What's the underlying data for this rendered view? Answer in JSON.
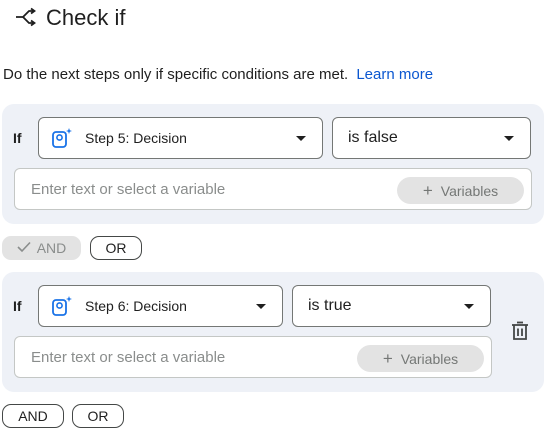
{
  "header": {
    "title": "Check if",
    "icon": "branch-icon"
  },
  "description": {
    "text": "Do the next steps only if specific conditions are met.",
    "link": "Learn more"
  },
  "condition_groups": [
    {
      "if_label": "If",
      "step": {
        "label": "Step 5: Decision",
        "icon": "step-decision-icon"
      },
      "operator": "is false",
      "value_placeholder": "Enter text or select a variable",
      "variables_label": "Variables"
    },
    {
      "if_label": "If",
      "step": {
        "label": "Step 6: Decision",
        "icon": "step-decision-icon"
      },
      "operator": "is true",
      "value_placeholder": "Enter text or select a variable",
      "variables_label": "Variables",
      "delete_icon": "trash-icon"
    }
  ],
  "connectors": [
    {
      "and_label": "AND",
      "or_label": "OR",
      "and_selected": true
    },
    {
      "and_label": "AND",
      "or_label": "OR",
      "and_selected": false
    }
  ],
  "colors": {
    "accent": "#0b57d0",
    "card": "#eef1f7",
    "step_icon": "#1a73e8"
  }
}
